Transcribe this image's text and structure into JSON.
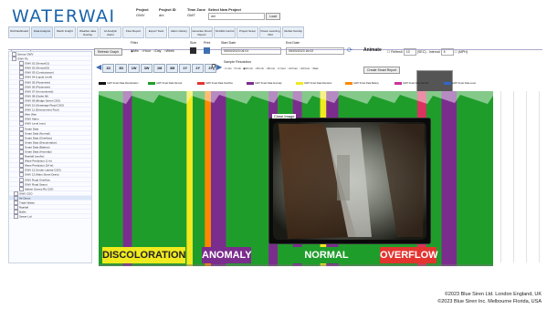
{
  "app": {
    "logo": "WATERWAI"
  },
  "header": {
    "project_label": "Project",
    "project_value": "GWV",
    "project_id_label": "Project ID",
    "project_id_value": "dnl",
    "tz_label": "Time Zone",
    "tz_value": "GMT",
    "select_label": "Select New Project",
    "select_value": "dnl",
    "load_label": "Load"
  },
  "nav": {
    "items": [
      {
        "label": "Old Dashboard"
      },
      {
        "label": "Data Analysis"
      },
      {
        "label": "Batch Insight"
      },
      {
        "label": "Weather data Overlay"
      },
      {
        "label": "AI Analytic Alerts"
      },
      {
        "label": "Flow Report"
      },
      {
        "label": "Export Tools"
      },
      {
        "label": "Alarm History"
      },
      {
        "label": "Generate Smart Report"
      },
      {
        "label": "SCADA Control"
      },
      {
        "label": "Project Setup"
      },
      {
        "label": "Power Learning Mtd"
      },
      {
        "label": "Global Overlay"
      }
    ]
  },
  "tab": {
    "label": "Main"
  },
  "tree": {
    "items": [
      "Sensor GWV",
      "GWV Pit",
      "GWV 01 (Sensor01)",
      "GWV 02 (Sensor02)",
      "GWV 03 (Conductance)",
      "GWV 04 (Liquid Level)",
      "GWV 05 (Flowmeter)",
      "GWV 06 (Flowmeter)",
      "GWV 07 (Unmonitored)",
      "GWV 08 (Outlet fill)",
      "GWV 09 (Bridge Street CSO)",
      "GWV 10 (Sewerage Road CSO)",
      "GWV 11 (Environment Pool)",
      "Weir Weir",
      "GWV Alarm",
      "GWV Level (mm)",
      "Smart Data",
      "Smart Data (Normal)",
      "Smart Data (Overflow)",
      "Smart Data (Discoloration)",
      "Smart Data (Battery)",
      "Smart Data (Anomaly)",
      "Rainfall (mm/hr)",
      "Wave Prediction (1 hr)",
      "Wave Prediction (24 hr)",
      "GWV 12 (Under Lateral CSO)",
      "GWV 13 (Main Street Drain)",
      "GWV Road Overflow",
      "GWV Road Seamt",
      "Salinet Survey Rd CSO",
      "GWV CSO",
      "Air Dmux",
      "Trade Waste",
      "Rainfall",
      "Bullet",
      "Sewer Ltd"
    ]
  },
  "controls": {
    "refresh_label": "Refresh Graph",
    "filter_label": "Filter",
    "filter_options": [
      "Min",
      "Hour",
      "Day",
      "Week"
    ],
    "size_label": "Size",
    "print_label": "Print",
    "start_label": "Start Date",
    "start_value": "05/03/2023 04:01",
    "end_label": "End Date",
    "end_value": "05/03/2023 16:02",
    "animate_label": "Animate",
    "refresh_opt": "Refresh",
    "refresh_interval": "10",
    "interval_label": "(SEC) - Interval",
    "interval_value": "5",
    "mpw_label": "(MPH)",
    "smart_report_label": "Create Smart Report",
    "ranges": [
      "1D",
      "3D",
      "1W",
      "3W",
      "1M",
      "3M",
      "1Y",
      "2Y",
      "3Y"
    ],
    "resolution_label": "Sample Resolution",
    "resolution_options": [
      "1 min",
      "5 min",
      "10 min",
      "15 min",
      "30 min",
      "1 hour",
      "12 hour",
      "24 hour",
      "Raw"
    ]
  },
  "legend": {
    "items": [
      {
        "label": "GWV Smart Data Discoloration",
        "color": "#111111"
      },
      {
        "label": "GWV Smart Data Normal",
        "color": "#1f9d2a"
      },
      {
        "label": "GWV Smart Data Overflow",
        "color": "#e3342f"
      },
      {
        "label": "GWV Smart Data Anomaly",
        "color": "#7b2d8e"
      },
      {
        "label": "GWV Smart Data Discolour",
        "color": "#f1ea1e"
      },
      {
        "label": "GWV Smart Data Battery",
        "color": "#ff8800"
      },
      {
        "label": "GWV Smart Data Rainfall",
        "color": "#cc3399"
      },
      {
        "label": "GWV Smart Data Level",
        "color": "#3366cc"
      }
    ]
  },
  "chart_data": {
    "type": "area",
    "title": "",
    "xlabel": "",
    "ylabel": "",
    "bands": [
      {
        "category": "normal",
        "width": 8,
        "color": "#1f9d2a"
      },
      {
        "category": "anomaly",
        "width": 3,
        "color": "#7b2d8e"
      },
      {
        "category": "normal",
        "width": 18,
        "color": "#1f9d2a"
      },
      {
        "category": "discoloration",
        "width": 2,
        "color": "#f1ea1e"
      },
      {
        "category": "normal",
        "width": 4,
        "color": "#1f9d2a"
      },
      {
        "category": "battery",
        "width": 2,
        "color": "#ff8800"
      },
      {
        "category": "anomaly",
        "width": 5,
        "color": "#7b2d8e"
      },
      {
        "category": "normal",
        "width": 14,
        "color": "#1f9d2a"
      },
      {
        "category": "anomaly",
        "width": 3,
        "color": "#7b2d8e"
      },
      {
        "category": "normal",
        "width": 5,
        "color": "#1f9d2a"
      },
      {
        "category": "anomaly",
        "width": 3,
        "color": "#7b2d8e"
      },
      {
        "category": "normal",
        "width": 6,
        "color": "#1f9d2a"
      },
      {
        "category": "discoloration",
        "width": 2,
        "color": "#f1ea1e"
      },
      {
        "category": "anomaly",
        "width": 4,
        "color": "#7b2d8e"
      },
      {
        "category": "normal",
        "width": 26,
        "color": "#1f9d2a"
      },
      {
        "category": "overflow",
        "width": 3,
        "color": "#d9345f"
      },
      {
        "category": "normal",
        "width": 5,
        "color": "#1f9d2a"
      },
      {
        "category": "anomaly",
        "width": 5,
        "color": "#7b2d8e"
      },
      {
        "category": "normal",
        "width": 12,
        "color": "#1f9d2a"
      }
    ]
  },
  "labels": [
    {
      "text": "DISCOLORATION",
      "bg": "#f1ea1e",
      "fg": "#222222"
    },
    {
      "text": "ANOMALY",
      "bg": "#7b2d8e",
      "fg": "#ffffff"
    },
    {
      "text": "NORMAL",
      "bg": "#1f9d2a",
      "fg": "#ffffff"
    },
    {
      "text": "OVERFLOW",
      "bg": "#e3342f",
      "fg": "#ffffff"
    }
  ],
  "popup": {
    "close_label": "Close Image"
  },
  "footer": {
    "line1": "©2023 Blue Siren Ltd. London England, UK",
    "line2": "©2023 Blue Siren Inc. Melbourne Florida, USA"
  }
}
